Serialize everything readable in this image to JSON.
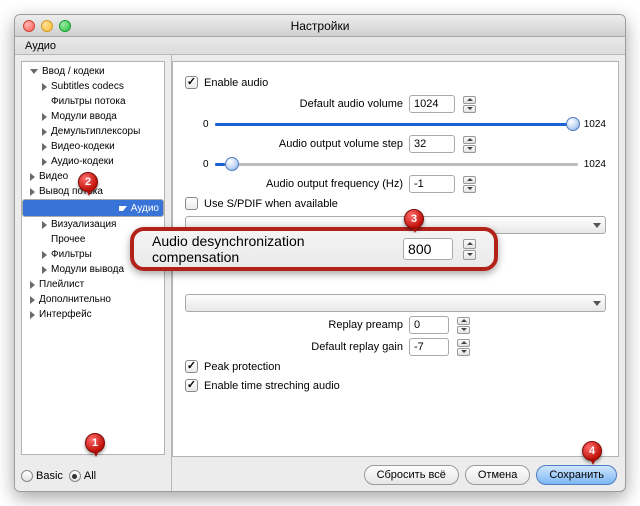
{
  "window": {
    "title": "Настройки"
  },
  "section": {
    "head": "Аудио"
  },
  "sidebar": {
    "items": [
      {
        "label": "Ввод / кодеки",
        "depth": 0,
        "tri": "d",
        "sel": false
      },
      {
        "label": "Subtitles codecs",
        "depth": 1,
        "tri": "r",
        "sel": false
      },
      {
        "label": "Фильтры потока",
        "depth": 1,
        "tri": "",
        "sel": false
      },
      {
        "label": "Модули ввода",
        "depth": 1,
        "tri": "r",
        "sel": false
      },
      {
        "label": "Демультиплексоры",
        "depth": 1,
        "tri": "r",
        "sel": false
      },
      {
        "label": "Видео-кодеки",
        "depth": 1,
        "tri": "r",
        "sel": false
      },
      {
        "label": "Аудио-кодеки",
        "depth": 1,
        "tri": "r",
        "sel": false
      },
      {
        "label": "Видео",
        "depth": 0,
        "tri": "r",
        "sel": false
      },
      {
        "label": "Вывод потока",
        "depth": 0,
        "tri": "r",
        "sel": false
      },
      {
        "label": "Аудио",
        "depth": 0,
        "tri": "d",
        "sel": true
      },
      {
        "label": "Визуализация",
        "depth": 1,
        "tri": "r",
        "sel": false
      },
      {
        "label": "Прочее",
        "depth": 1,
        "tri": "",
        "sel": false
      },
      {
        "label": "Фильтры",
        "depth": 1,
        "tri": "r",
        "sel": false
      },
      {
        "label": "Модули вывода",
        "depth": 1,
        "tri": "r",
        "sel": false
      },
      {
        "label": "Плейлист",
        "depth": 0,
        "tri": "r",
        "sel": false
      },
      {
        "label": "Дополнительно",
        "depth": 0,
        "tri": "r",
        "sel": false
      },
      {
        "label": "Интерфейс",
        "depth": 0,
        "tri": "r",
        "sel": false
      }
    ]
  },
  "mode": {
    "basic": "Basic",
    "all": "All"
  },
  "main": {
    "enable_audio": "Enable audio",
    "default_volume_lbl": "Default audio volume",
    "default_volume_val": "1024",
    "slider1_left": "0",
    "slider1_right": "1024",
    "output_step_lbl": "Audio output volume step",
    "output_step_val": "32",
    "slider2_left": "0",
    "slider2_right": "1024",
    "output_freq_lbl": "Audio output frequency (Hz)",
    "output_freq_val": "-1",
    "spdif": "Use S/PDIF when available",
    "replay_preamp_lbl": "Replay preamp",
    "replay_preamp_val": "0",
    "default_gain_lbl": "Default replay gain",
    "default_gain_val": "-7",
    "peak": "Peak protection",
    "timestretch": "Enable time streching audio"
  },
  "highlight": {
    "label": "Audio desynchronization compensation",
    "value": "800"
  },
  "buttons": {
    "reset": "Сбросить всё",
    "cancel": "Отмена",
    "save": "Сохранить"
  },
  "pins": {
    "p1": "1",
    "p2": "2",
    "p3": "3",
    "p4": "4"
  }
}
